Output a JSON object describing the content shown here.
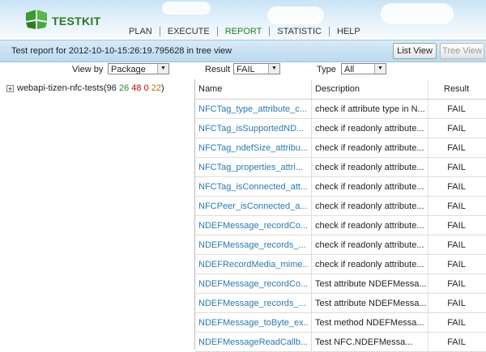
{
  "header": {
    "logo_text": "TESTKIT",
    "nav": [
      "PLAN",
      "EXECUTE",
      "REPORT",
      "STATISTIC",
      "HELP"
    ],
    "active_nav": "REPORT"
  },
  "infobar": {
    "title": "Test report for 2012-10-10-15:26:19.795628 in tree view",
    "list_view": "List View",
    "tree_view": "Tree View"
  },
  "filters": {
    "view_by_label": "View by",
    "view_by_value": "Package",
    "result_label": "Result",
    "result_value": "FAIL",
    "type_label": "Type",
    "type_value": "All"
  },
  "tree": {
    "root_label": "webapi-tizen-nfc-tests(",
    "counts": {
      "total": "96",
      "pass": "26",
      "fail": "48",
      "block": "0",
      "notrun": "22"
    },
    "colors": {
      "pass": "#2a8a2a",
      "fail": "#cc0000",
      "block": "#cc0000",
      "notrun": "#c07000"
    }
  },
  "table": {
    "columns": [
      "Name",
      "Description",
      "Result"
    ],
    "rows": [
      {
        "name": "NFCTag_type_attribute_c...",
        "desc": "check if attribute type in N...",
        "result": "FAIL"
      },
      {
        "name": "NFCTag_isSupportedND...",
        "desc": "check if readonly attribute...",
        "result": "FAIL"
      },
      {
        "name": "NFCTag_ndefSize_attribu...",
        "desc": "check if readonly attribute...",
        "result": "FAIL"
      },
      {
        "name": "NFCTag_properties_attri...",
        "desc": "check if readonly attribute...",
        "result": "FAIL"
      },
      {
        "name": "NFCTag_isConnected_att...",
        "desc": "check if readonly attribute...",
        "result": "FAIL"
      },
      {
        "name": "NFCPeer_isConnected_a...",
        "desc": "check if readonly attribute...",
        "result": "FAIL"
      },
      {
        "name": "NDEFMessage_recordCo...",
        "desc": "check if readonly attribute...",
        "result": "FAIL"
      },
      {
        "name": "NDEFMessage_records_...",
        "desc": "check if readonly attribute...",
        "result": "FAIL"
      },
      {
        "name": "NDEFRecordMedia_mime...",
        "desc": "check if readonly attribute...",
        "result": "FAIL"
      },
      {
        "name": "NDEFMessage_recordCo...",
        "desc": "Test attribute NDEFMessa...",
        "result": "FAIL"
      },
      {
        "name": "NDEFMessage_records_...",
        "desc": "Test attribute NDEFMessa...",
        "result": "FAIL"
      },
      {
        "name": "NDEFMessage_toByte_ex...",
        "desc": "Test method NDEFMessa...",
        "result": "FAIL"
      },
      {
        "name": "NDEFMessageReadCallb...",
        "desc": "Test NFC.NDEFMessa...",
        "result": "FAIL"
      }
    ]
  }
}
